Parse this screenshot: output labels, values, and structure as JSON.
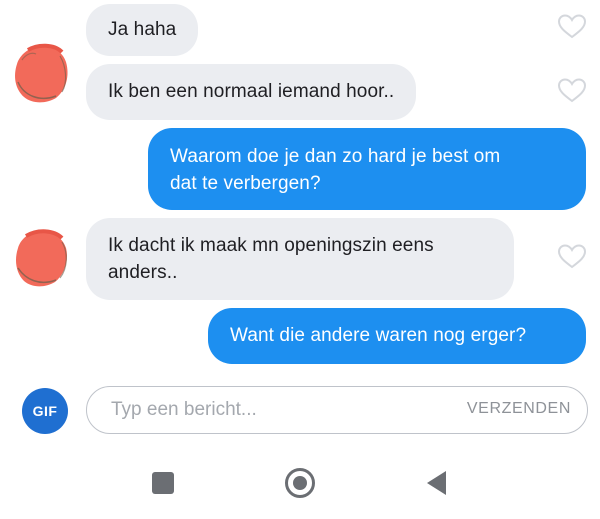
{
  "messages": [
    {
      "direction": "incoming",
      "text": "Ja haha"
    },
    {
      "direction": "incoming",
      "text": "Ik ben een normaal iemand hoor.."
    },
    {
      "direction": "outgoing",
      "lines": [
        "Waarom doe je dan zo hard je best om",
        "dat te verbergen?"
      ]
    },
    {
      "direction": "incoming",
      "lines": [
        "Ik dacht ik maak mn openingszin eens",
        "anders.."
      ]
    },
    {
      "direction": "outgoing",
      "text": "Want die andere waren nog erger?"
    }
  ],
  "composer": {
    "gif_label": "GIF",
    "placeholder": "Typ een bericht...",
    "send_label": "VERZENDEN"
  },
  "colors": {
    "incoming_bubble": "#ebedf1",
    "outgoing_bubble": "#1d8ff0",
    "gif_button": "#1f6fd1",
    "avatar_scribble": "#f26a5a"
  },
  "nav_icons": [
    "recents-square-icon",
    "home-circle-icon",
    "back-triangle-icon"
  ]
}
